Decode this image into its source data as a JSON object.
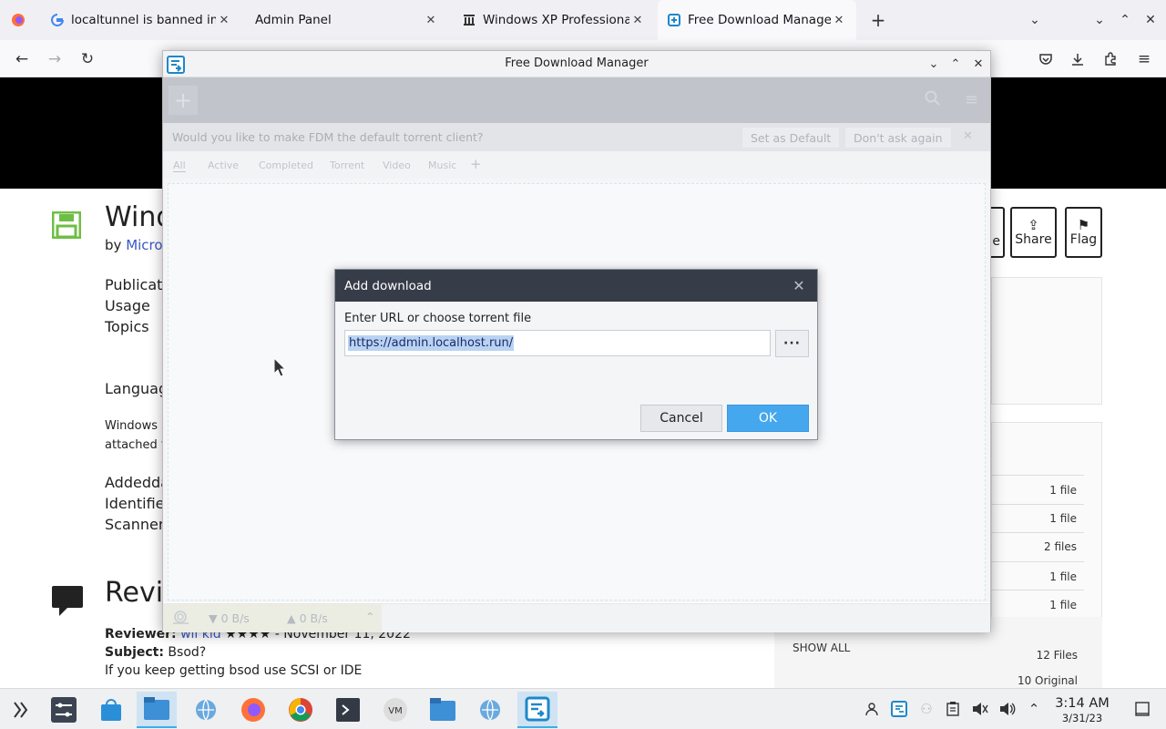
{
  "browser": {
    "tabs": [
      {
        "label": "localtunnel is banned in cv",
        "icon": "google-icon"
      },
      {
        "label": "Admin Panel",
        "icon": ""
      },
      {
        "label": "Windows XP Professional x",
        "icon": "archive-org-icon"
      },
      {
        "label": "Free Download Manager fo",
        "icon": "fdm-icon"
      }
    ],
    "new_tab_label": "+"
  },
  "webpage": {
    "title": "Wind",
    "by_label": "by",
    "author": "Micros",
    "fields": [
      "Publicati",
      "Usage",
      "Topics"
    ],
    "language_label": "Languag",
    "desc_line1": "Windows",
    "desc_line2": "attached t",
    "meta_fields": [
      "Addedda",
      "Identifier",
      "Scanner"
    ],
    "reviews_title": "Revie",
    "reviewer_label": "Reviewer:",
    "reviewer_name": "wli kid",
    "reviewer_stars": "★★★★",
    "review_date": "- November 11, 2022",
    "subject_label": "Subject:",
    "subject": "Bsod?",
    "review_body": "If you keep getting bsod use SCSI or IDE",
    "share_label": "Share",
    "flag_label": "Flag",
    "partial_btn_label": "e",
    "file_counts": [
      "1 file",
      "1 file",
      "2 files",
      "1 file",
      "1 file"
    ],
    "show_all": "SHOW ALL",
    "total_files": "12 Files",
    "original": "10 Original"
  },
  "fdm": {
    "window_title": "Free Download Manager",
    "prompt_text": "Would you like to make FDM the default torrent client?",
    "set_default": "Set as Default",
    "dont_ask": "Don't ask again",
    "filters": [
      "All",
      "Active",
      "Completed",
      "Torrent",
      "Video",
      "Music"
    ],
    "add_filter": "+",
    "download_speed": "▼ 0 B/s",
    "upload_speed": "▲ 0 B/s"
  },
  "dialog": {
    "title": "Add download",
    "label": "Enter URL or choose torrent file",
    "url_value": "https://admin.localhost.run/",
    "browse_label": "···",
    "cancel": "Cancel",
    "ok": "OK"
  },
  "taskbar": {
    "time": "3:14 AM",
    "date": "3/31/23"
  },
  "colors": {
    "accent": "#45a7ee",
    "dialog_header": "#373c49",
    "link": "#3b57c4",
    "fdm_toolbar": "#a9aeb7"
  }
}
